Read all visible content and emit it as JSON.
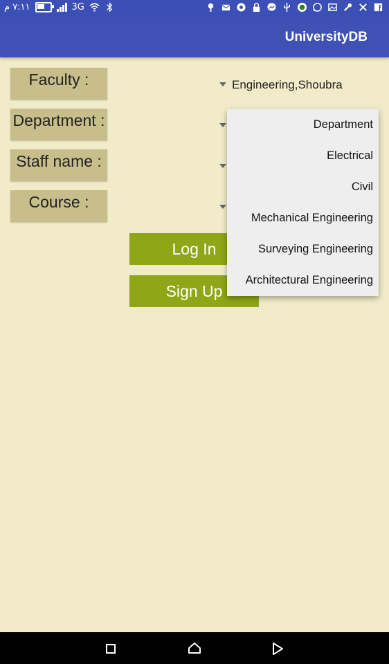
{
  "status_bar": {
    "time": "٧:١١ م",
    "network": "3G",
    "battery_level": 0.7,
    "left_icons": [
      "battery-icon",
      "signal-icon",
      "wifi-icon",
      "bluetooth-icon"
    ],
    "right_icons": [
      "pin-icon",
      "mail-icon",
      "chrome-icon",
      "lock-icon",
      "messenger-icon",
      "usb-icon",
      "app-icon",
      "whatsapp-icon",
      "image-icon",
      "wrench-icon",
      "tools-icon",
      "facebook-icon"
    ]
  },
  "app_bar": {
    "title": "UniversityDB"
  },
  "form": {
    "faculty_label": "Faculty :",
    "department_label": "Department :",
    "staff_label": "Staff name :",
    "course_label": "Course :",
    "faculty_value": "Engineering,Shoubra"
  },
  "buttons": {
    "login": "Log In",
    "signup": "Sign Up"
  },
  "dropdown": {
    "items": [
      "Department",
      "Electrical",
      "Civil",
      "Mechanical Engineering",
      "Surveying Engineering",
      "Architectural Engineering"
    ]
  },
  "nav_bar": {
    "icons": [
      "recents-icon",
      "home-icon",
      "back-icon"
    ]
  },
  "colors": {
    "app_bar": "#3f51b5",
    "background": "#f1ebca",
    "label_bg": "#c7be8c",
    "button": "#8fa616",
    "dropdown_bg": "#eeeeee"
  }
}
